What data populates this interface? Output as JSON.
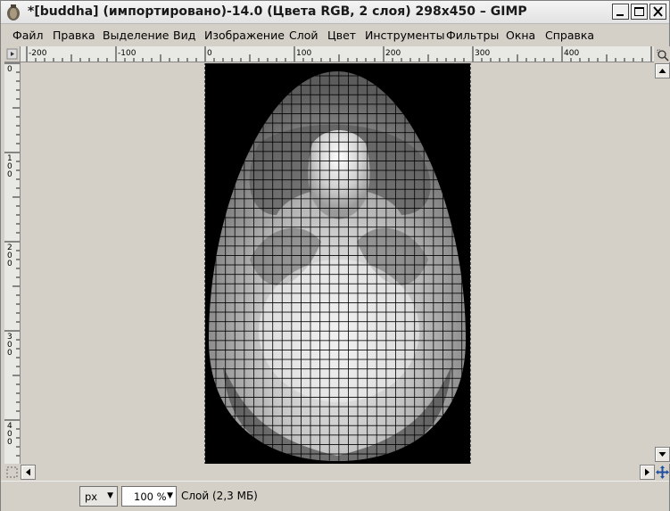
{
  "window": {
    "title": "*[buddha] (импортировано)-14.0 (Цвета RGB, 2 слоя) 298x450 – GIMP"
  },
  "menubar": {
    "items": [
      {
        "key": "file",
        "label": "Файл"
      },
      {
        "key": "edit",
        "label": "Правка"
      },
      {
        "key": "select",
        "label": "Выделение"
      },
      {
        "key": "view",
        "label": "Вид"
      },
      {
        "key": "image",
        "label": "Изображение"
      },
      {
        "key": "layer",
        "label": "Слой"
      },
      {
        "key": "colors",
        "label": "Цвет"
      },
      {
        "key": "tools",
        "label": "Инструменты"
      },
      {
        "key": "filters",
        "label": "Фильтры"
      },
      {
        "key": "windows",
        "label": "Окна"
      },
      {
        "key": "help",
        "label": "Справка"
      }
    ]
  },
  "rulers": {
    "horizontal_labels": [
      "-200",
      "-100",
      "0",
      "100",
      "200",
      "300",
      "400"
    ],
    "vertical_labels": [
      "0",
      "100",
      "200",
      "300",
      "400"
    ]
  },
  "statusbar": {
    "unit": "px",
    "zoom": "100 %",
    "layer_info": "Слой (2,3 МБ)"
  }
}
